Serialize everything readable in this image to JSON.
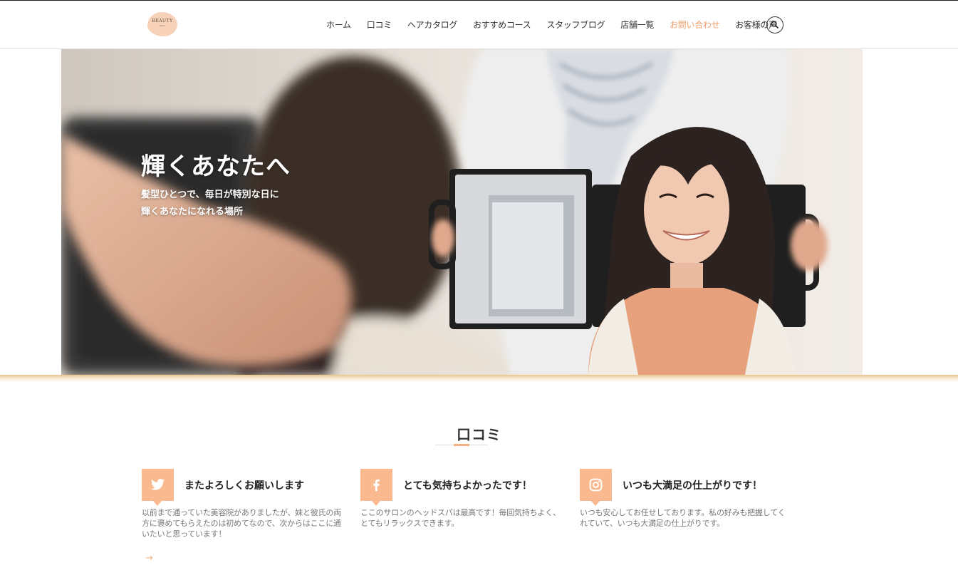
{
  "header": {
    "logo_text": "BEAUTY",
    "logo_sub": "salon",
    "nav": [
      {
        "label": "ホーム"
      },
      {
        "label": "口コミ"
      },
      {
        "label": "ヘアカタログ"
      },
      {
        "label": "おすすめコース"
      },
      {
        "label": "スタッフブログ"
      },
      {
        "label": "店舗一覧"
      },
      {
        "label": "お問い合わせ",
        "active": true
      },
      {
        "label": "お客様の声"
      }
    ],
    "search_icon": "search-icon"
  },
  "hero": {
    "title": "輝くあなたへ",
    "subtitle_line1": "髪型ひとつで、毎日が特別な日に",
    "subtitle_line2": "輝くあなたになれる場所"
  },
  "reviews": {
    "section_title": "口コミ",
    "cards": [
      {
        "icon": "twitter-icon",
        "title": "またよろしくお願いします",
        "body": "以前まで通っていた美容院がありましたが、妹と彼氏の両方に褒めてもらえたのは初めてなので、次からはここに通いたいと思っています！",
        "arrow": "→"
      },
      {
        "icon": "facebook-icon",
        "title": "とても気持ちよかったです！",
        "body": "ここのサロンのヘッドスパは最高です！毎回気持ちよく、とてもリラックスできます。"
      },
      {
        "icon": "instagram-icon",
        "title": "いつも大満足の仕上がりです！",
        "body": "いつも安心してお任せしております。私の好みも把握してくれていて、いつも大満足の仕上がりです。"
      }
    ]
  },
  "colors": {
    "accent": "#f0a06c",
    "icon_bg": "#fbb98f"
  }
}
